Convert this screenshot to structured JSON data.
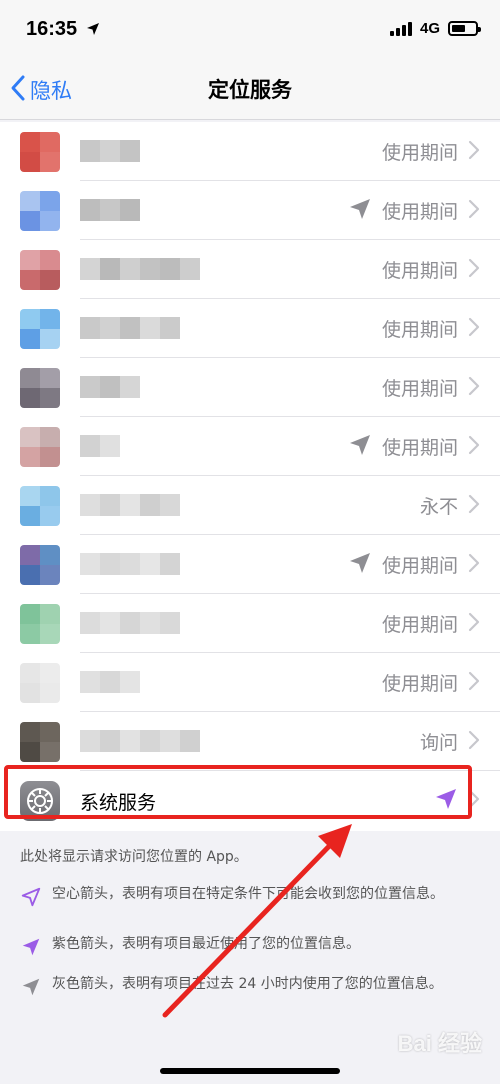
{
  "status_bar": {
    "time": "16:35",
    "network": "4G"
  },
  "nav": {
    "back_label": "隐私",
    "title": "定位服务"
  },
  "rows": [
    {
      "status": "使用期间",
      "arrow": false,
      "icon_colors": [
        "#d9534a",
        "#e06a62",
        "#d24c45",
        "#e2736c"
      ],
      "name_colors": [
        "#c8c8c8",
        "#d2d2d2",
        "#c4c4c4"
      ]
    },
    {
      "status": "使用期间",
      "arrow": true,
      "icon_colors": [
        "#a9c4f0",
        "#7ba4ea",
        "#6b93e3",
        "#92b4ee"
      ],
      "name_colors": [
        "#bdbdbd",
        "#c7c7c7",
        "#b9b9b9"
      ]
    },
    {
      "status": "使用期间",
      "arrow": false,
      "icon_colors": [
        "#e0a2a6",
        "#d98b8f",
        "#c96a6c",
        "#b85c5e"
      ],
      "name_colors": [
        "#d4d4d4",
        "#b9b9b9",
        "#cfcfcf",
        "#c2c2c2",
        "#bcbcbc",
        "#cdcdcd"
      ]
    },
    {
      "status": "使用期间",
      "arrow": false,
      "icon_colors": [
        "#8fcaf0",
        "#72b4ea",
        "#5e9fe5",
        "#a6d2f2"
      ],
      "name_colors": [
        "#c9c9c9",
        "#d1d1d1",
        "#c1c1c1",
        "#dadada",
        "#cbcbcb"
      ]
    },
    {
      "status": "使用期间",
      "arrow": false,
      "icon_colors": [
        "#8f8a93",
        "#a39ea8",
        "#6e6873",
        "#7e7983"
      ],
      "name_colors": [
        "#cacaca",
        "#c0c0c0",
        "#d6d6d6"
      ]
    },
    {
      "status": "使用期间",
      "arrow": true,
      "icon_colors": [
        "#d9c2c2",
        "#c7aeae",
        "#d4a3a3",
        "#c29090"
      ],
      "name_colors": [
        "#d2d2d2",
        "#e0e0e0"
      ]
    },
    {
      "status": "永不",
      "arrow": false,
      "icon_colors": [
        "#a9d6f0",
        "#8ec6ea",
        "#6aaee1",
        "#98cbee"
      ],
      "name_colors": [
        "#dedede",
        "#d3d3d3",
        "#e4e4e4",
        "#cfcfcf",
        "#d8d8d8"
      ]
    },
    {
      "status": "使用期间",
      "arrow": true,
      "icon_colors": [
        "#7e6ba8",
        "#5f8fc4",
        "#4a6fb0",
        "#6b84bd"
      ],
      "name_colors": [
        "#e2e2e2",
        "#d8d8d8",
        "#dcdcdc",
        "#e6e6e6",
        "#d4d4d4"
      ]
    },
    {
      "status": "使用期间",
      "arrow": false,
      "icon_colors": [
        "#7fc39a",
        "#9fd2b0",
        "#8ccaa4",
        "#a8d7b8"
      ],
      "name_colors": [
        "#dcdcdc",
        "#e4e4e4",
        "#d6d6d6",
        "#e0e0e0",
        "#d9d9d9"
      ]
    },
    {
      "status": "使用期间",
      "arrow": false,
      "icon_colors": [
        "#e6e6e6",
        "#ececec",
        "#e2e2e2",
        "#eaeaea"
      ],
      "name_colors": [
        "#e0e0e0",
        "#d8d8d8",
        "#e4e4e4"
      ]
    },
    {
      "status": "询问",
      "arrow": false,
      "icon_colors": [
        "#5e5851",
        "#6d665e",
        "#4f4a44",
        "#777069"
      ],
      "name_colors": [
        "#dcdcdc",
        "#d2d2d2",
        "#e2e2e2",
        "#d6d6d6",
        "#dedede",
        "#d0d0d0"
      ]
    }
  ],
  "system_services": {
    "label": "系统服务"
  },
  "footer": {
    "note": "此处将显示请求访问您位置的 App。",
    "legend": [
      {
        "icon": "hollow-arrow-icon",
        "text": "空心箭头，表明有项目在特定条件下可能会收到您的位置信息。"
      },
      {
        "icon": "purple-arrow-icon",
        "text": "紫色箭头，表明有项目最近使用了您的位置信息。"
      },
      {
        "icon": "gray-arrow-icon",
        "text": "灰色箭头，表明有项目在过去 24 小时内使用了您的位置信息。"
      }
    ]
  },
  "colors": {
    "accent": "#2f7cf6",
    "purple": "#9b5ce6",
    "gray_arrow": "#8e8e93",
    "highlight": "#e8241f"
  },
  "watermark": "Bai 经验"
}
